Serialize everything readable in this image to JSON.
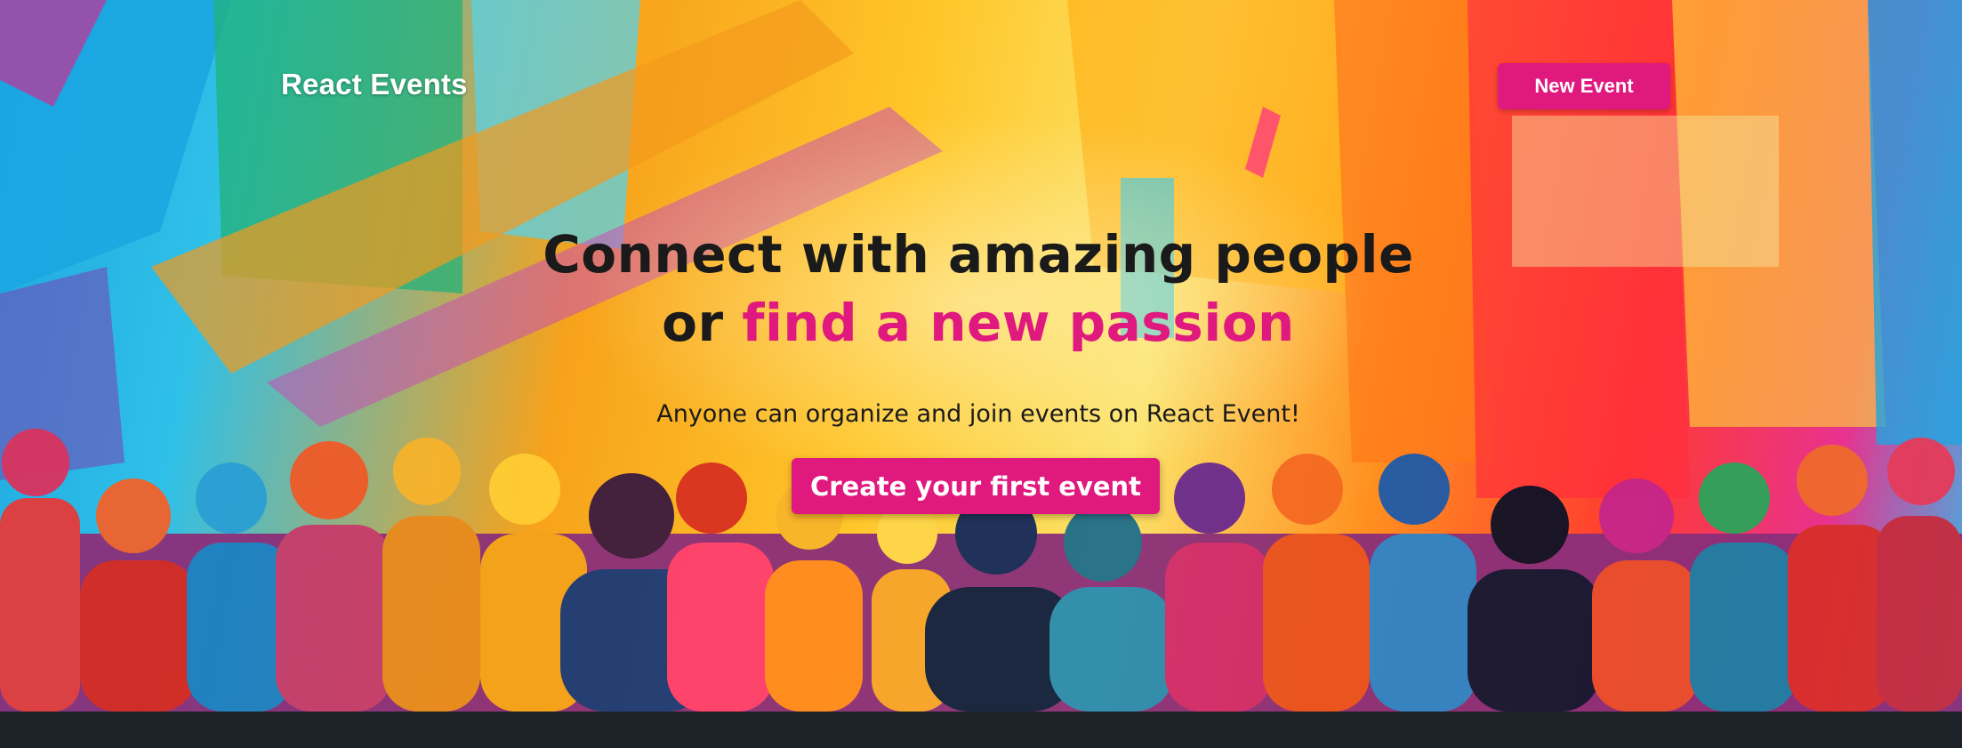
{
  "nav": {
    "brand": "React Events",
    "new_event_label": "New Event"
  },
  "hero": {
    "headline_line1": "Connect with amazing people",
    "headline_line2_prefix": "or ",
    "headline_line2_accent": "find a new passion",
    "subheading": "Anyone can organize and join events on React Event!",
    "cta_label": "Create your first event"
  },
  "colors": {
    "accent": "#e0197f",
    "footer_bg": "#1d2229"
  }
}
